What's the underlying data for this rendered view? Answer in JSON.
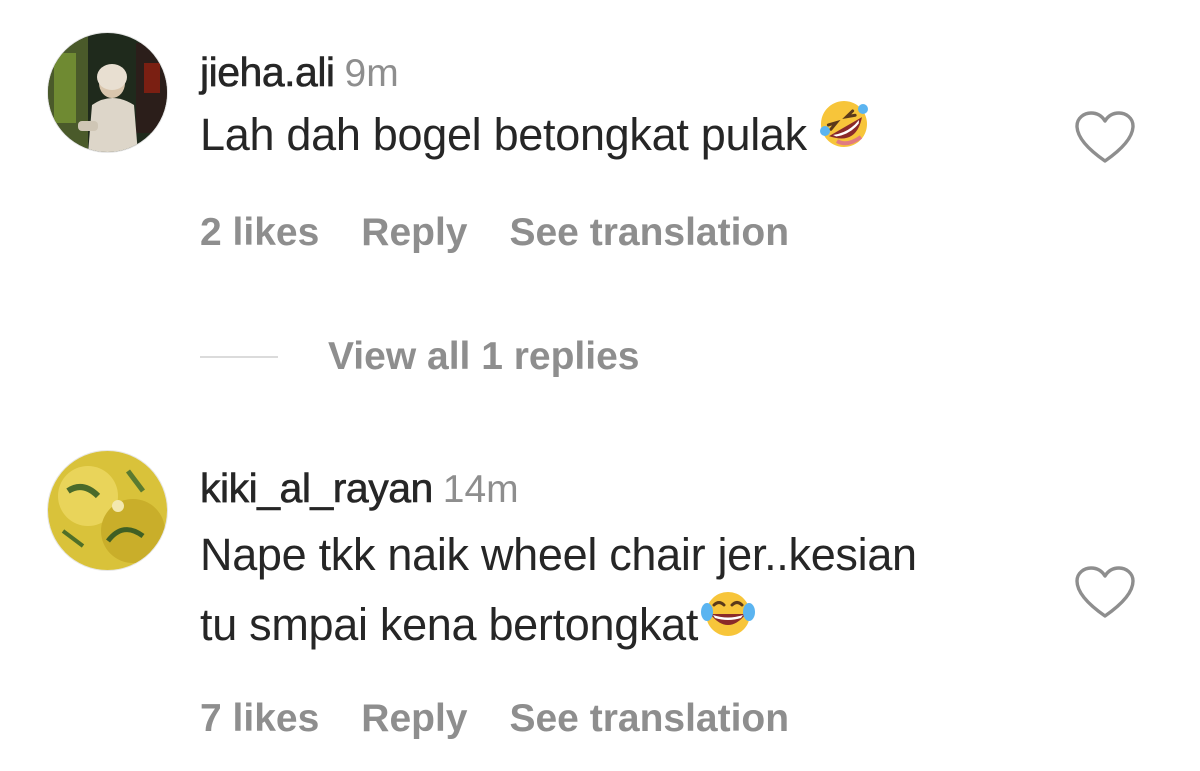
{
  "comments": [
    {
      "username": "jieha.ali",
      "time": "9m",
      "text_lines": [
        "Lah dah bogel betongkat pulak"
      ],
      "emoji": "rolling-on-floor-laughing",
      "likes": "2 likes",
      "reply": "Reply",
      "translate": "See translation",
      "avatar_icon": "avatar-photo-woman"
    },
    {
      "username": "kiki_al_rayan",
      "time": "14m",
      "text_lines": [
        "Nape tkk naik wheel chair jer..kesian",
        "tu smpai kena bertongkat"
      ],
      "emoji": "face-with-tears-of-joy",
      "likes": "7 likes",
      "reply": "Reply",
      "translate": "See translation",
      "avatar_icon": "avatar-photo-yellow"
    }
  ],
  "replies": {
    "label": "View all 1 replies"
  },
  "icons": {
    "like": "heart-outline-icon"
  },
  "colors": {
    "text": "#262626",
    "secondary": "#8e8e8e",
    "divider": "#dbdbdb"
  }
}
